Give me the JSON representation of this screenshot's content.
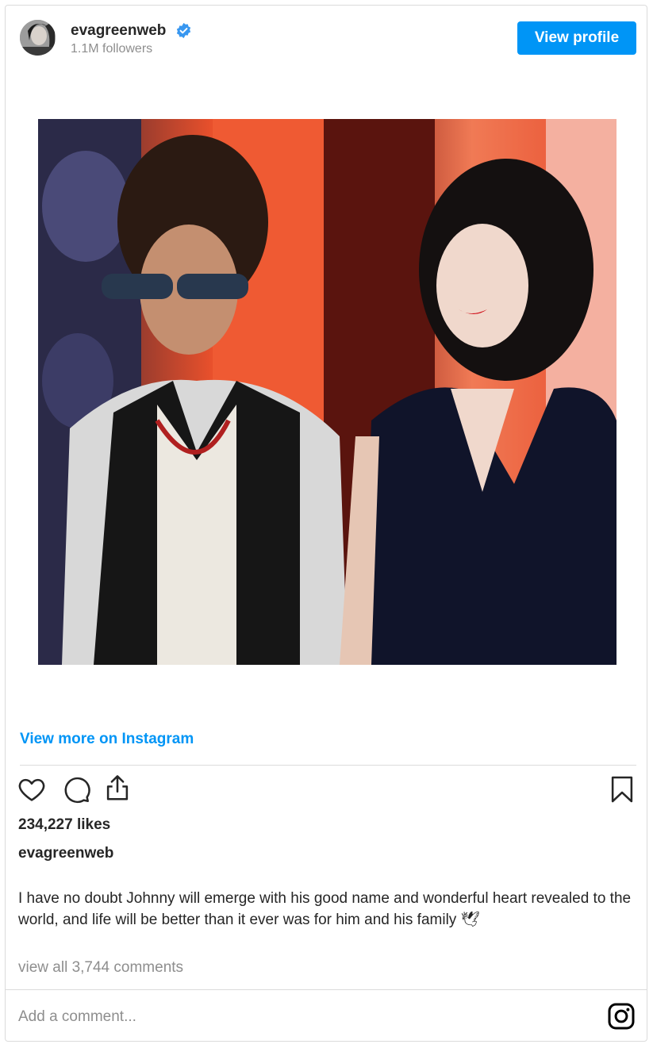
{
  "post": {
    "username": "evagreenweb",
    "followers": "1.1M followers",
    "view_profile_label": "View profile",
    "verified_icon": "verified-badge-icon",
    "view_more_label": "View more on Instagram",
    "likes": "234,227 likes",
    "caption_user": "evagreenweb",
    "caption_text": "I have no doubt Johnny will emerge with his good name and wonderful heart revealed to the world, and life will be better than it ever was for him and his family 🕊",
    "comments_link": "view all 3,744 comments",
    "comment_placeholder": "Add a comment..."
  },
  "actions": {
    "like_icon": "heart-icon",
    "comment_icon": "comment-icon",
    "share_icon": "share-icon",
    "save_icon": "bookmark-icon",
    "logo_icon": "instagram-logo-icon"
  },
  "colors": {
    "accent": "#0095f6",
    "text": "#262626",
    "muted": "#8e8e8e",
    "border": "#dbdbdb"
  }
}
